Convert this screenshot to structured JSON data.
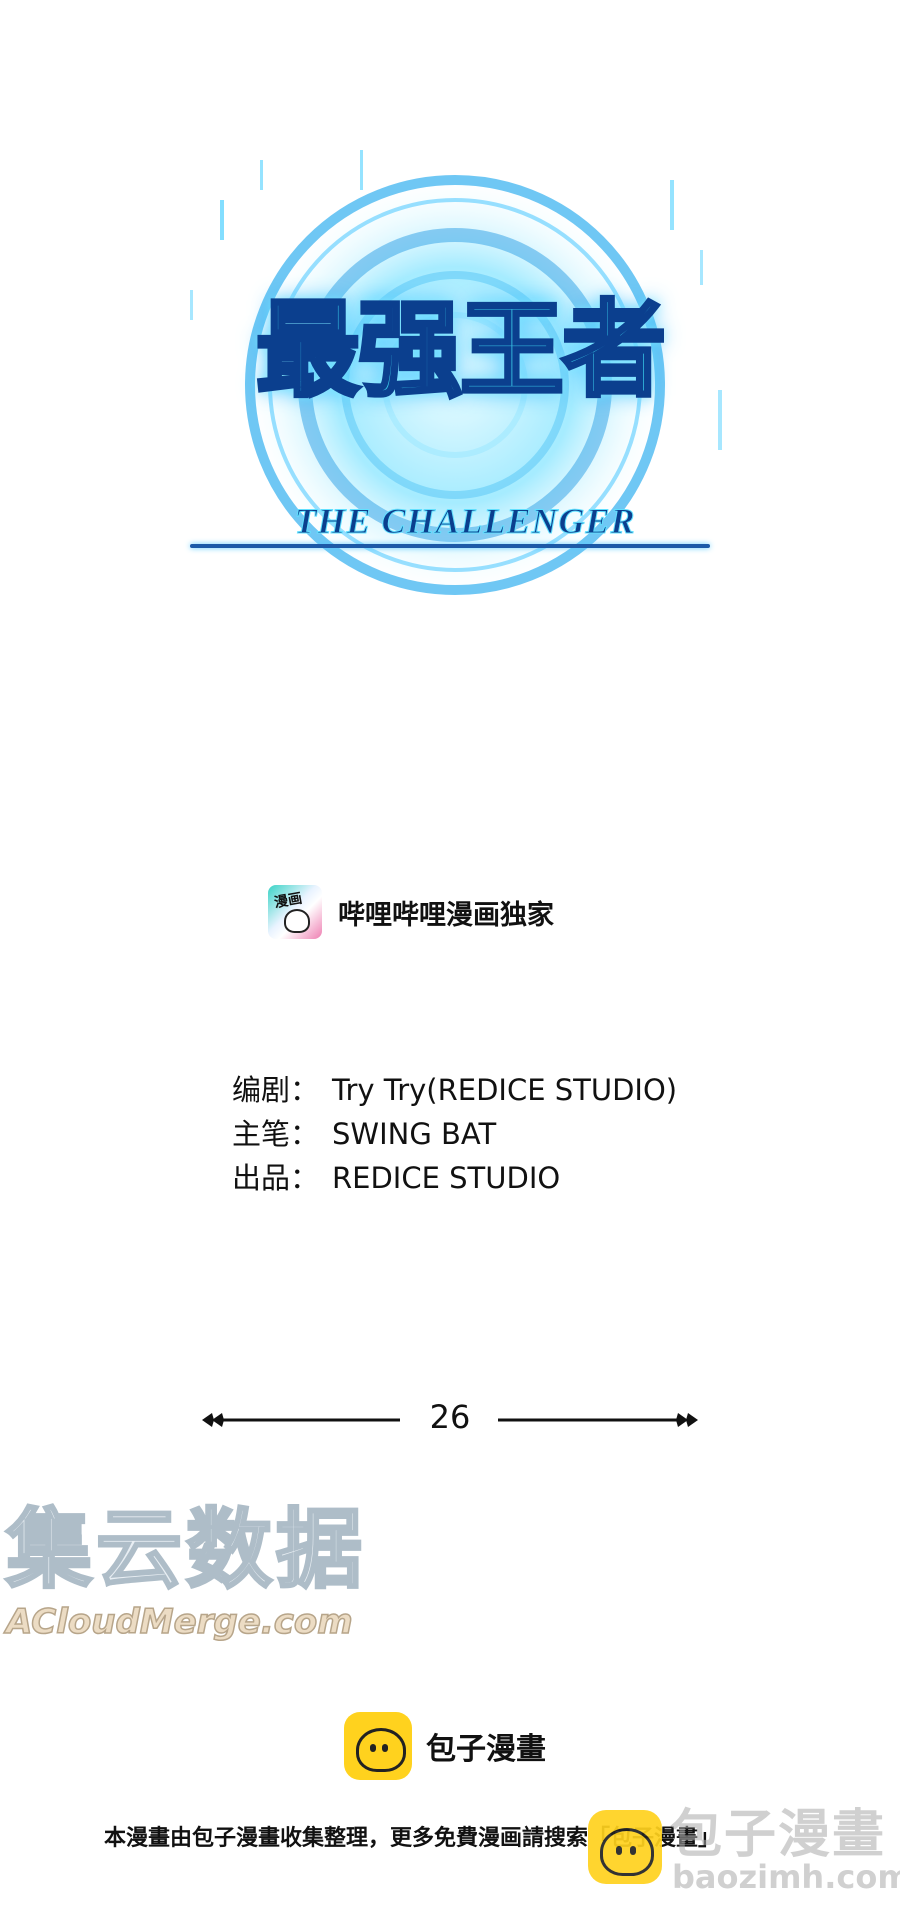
{
  "logo": {
    "title_cn": "最强王者",
    "title_en": "THE CHALLENGER"
  },
  "exclusive": {
    "icon_text": "漫画",
    "label": "哔哩哔哩漫画独家"
  },
  "credits": [
    {
      "label": "编剧：",
      "value": "Try Try(REDICE STUDIO)"
    },
    {
      "label": "主笔：",
      "value": "SWING BAT"
    },
    {
      "label": "出品：",
      "value": "REDICE STUDIO"
    }
  ],
  "chapter": {
    "number": "26"
  },
  "watermark": {
    "cn": "集云数据",
    "en": "ACloudMerge.com"
  },
  "footer": {
    "brand": "包子漫畫",
    "notice": "本漫畫由包子漫畫收集整理，更多免費漫画請搜索「包子漫畫」",
    "corner_cn": "包子漫畫",
    "corner_url": "baozimh.com"
  },
  "colors": {
    "logo_cyan": "#39c7e8",
    "logo_navy": "#0b3f8e",
    "baozi_yellow": "#ffd21e"
  }
}
